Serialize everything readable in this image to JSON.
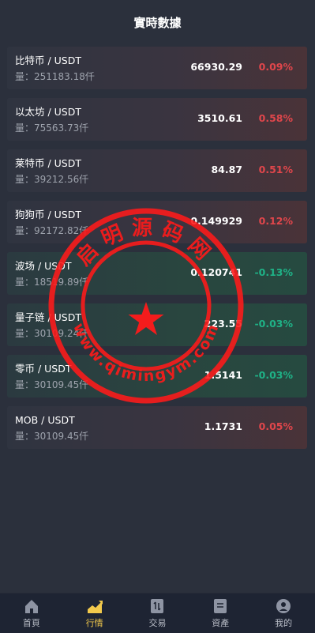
{
  "header": {
    "title": "實時數據"
  },
  "rows": [
    {
      "pair": "比特币 / USDT",
      "vol": "量：251183.18仟",
      "price": "66930.29",
      "change": "0.09%",
      "dir": "up"
    },
    {
      "pair": "以太坊 / USDT",
      "vol": "量：75563.73仟",
      "price": "3510.61",
      "change": "0.58%",
      "dir": "up"
    },
    {
      "pair": "莱特币 / USDT",
      "vol": "量：39212.56仟",
      "price": "84.87",
      "change": "0.51%",
      "dir": "up"
    },
    {
      "pair": "狗狗币 / USDT",
      "vol": "量：92172.82仟",
      "price": "0.149929",
      "change": "0.12%",
      "dir": "up"
    },
    {
      "pair": "波场 / USDT",
      "vol": "量：18519.89仟",
      "price": "0.120741",
      "change": "-0.13%",
      "dir": "down"
    },
    {
      "pair": "量子链 / USDT",
      "vol": "量：30109.24仟",
      "price": "223.55",
      "change": "-0.03%",
      "dir": "down"
    },
    {
      "pair": "零币 / USDT",
      "vol": "量：30109.45仟",
      "price": "1.5141",
      "change": "-0.03%",
      "dir": "down"
    },
    {
      "pair": "MOB / USDT",
      "vol": "量：30109.45仟",
      "price": "1.1731",
      "change": "0.05%",
      "dir": "up"
    }
  ],
  "tabs": [
    {
      "label": "首頁",
      "icon": "home-icon"
    },
    {
      "label": "行情",
      "icon": "market-chart-icon",
      "active": true
    },
    {
      "label": "交易",
      "icon": "trade-icon"
    },
    {
      "label": "資產",
      "icon": "assets-icon"
    },
    {
      "label": "我的",
      "icon": "profile-icon"
    }
  ],
  "watermark": {
    "text_top": "启明源码网",
    "text_bottom": "www.qimingym.com"
  },
  "colors": {
    "up": "#e0464b",
    "down": "#1fb287",
    "active_tab": "#f2c94c",
    "stamp": "#ff1a1a"
  }
}
